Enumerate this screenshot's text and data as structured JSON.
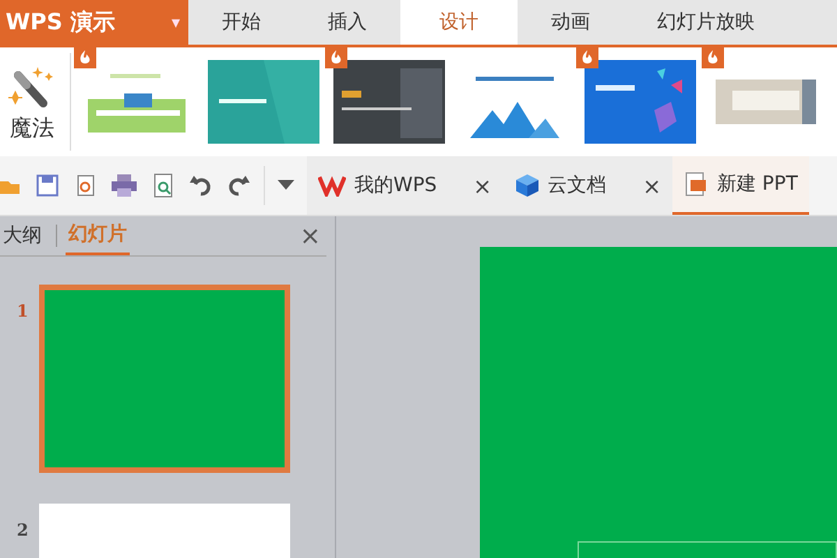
{
  "app_button": {
    "label": "WPS 演示",
    "caret": "▾"
  },
  "ribbon_tabs": [
    {
      "label": "开始",
      "selected": false
    },
    {
      "label": "插入",
      "selected": false
    },
    {
      "label": "设计",
      "selected": true
    },
    {
      "label": "动画",
      "selected": false
    },
    {
      "label": "幻灯片放映",
      "selected": false
    }
  ],
  "magic_button": {
    "label": "魔法"
  },
  "templates": [
    {
      "badge": true
    },
    {
      "badge": false
    },
    {
      "badge": true
    },
    {
      "badge": false
    },
    {
      "badge": true
    },
    {
      "badge": true
    }
  ],
  "doc_tabs": [
    {
      "kind": "wps",
      "label": "我的WPS",
      "close": "×",
      "selected": false
    },
    {
      "kind": "cloud",
      "label": "云文档",
      "close": "×",
      "selected": false
    },
    {
      "kind": "doc",
      "label": "新建 PPT",
      "selected": true
    }
  ],
  "panel": {
    "tabs": [
      {
        "label": "大纲",
        "selected": false
      },
      {
        "label": "幻灯片",
        "selected": true
      }
    ],
    "close": "×",
    "slides": [
      {
        "number": "1",
        "selected": true,
        "color": "#00ad4c"
      },
      {
        "number": "2",
        "selected": false,
        "color": "#ffffff"
      }
    ]
  },
  "canvas": {
    "color": "#00ad4c"
  }
}
